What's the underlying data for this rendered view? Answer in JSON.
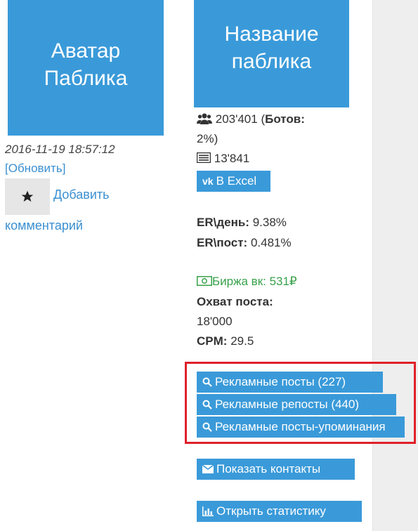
{
  "avatar": {
    "line1": "Аватар",
    "line2": "Паблика"
  },
  "public_title": {
    "line1": "Название",
    "line2": "паблика"
  },
  "timestamp": "2016-11-19 18:57:12",
  "refresh_link": "[Обновить]",
  "add_comment": {
    "line1": "Добавить",
    "line2": "комментарий"
  },
  "stats": {
    "followers": "203'401",
    "bots_label": "Ботов:",
    "bots_value": "2%)",
    "bots_open": "(",
    "posts": "13'841",
    "excel_button": "В Excel",
    "er_day_label": "ER\\день:",
    "er_day_value": "9.38%",
    "er_post_label": "ER\\пост:",
    "er_post_value": "0.481%",
    "exchange": "Биржа вк: 531₽",
    "reach_label": "Охват поста:",
    "reach_value": "18'000",
    "cpm_label": "CPM:",
    "cpm_value": "29.5"
  },
  "ad_buttons": [
    "Рекламные посты (227)",
    "Рекламные репосты (440)",
    "Рекламные посты-упоминания"
  ],
  "contacts_button": "Показать контакты",
  "statistics_button": "Открыть статистику",
  "colors": {
    "accent": "#3a9ad9",
    "highlight": "#e0202a",
    "exchange": "#38a14a"
  }
}
